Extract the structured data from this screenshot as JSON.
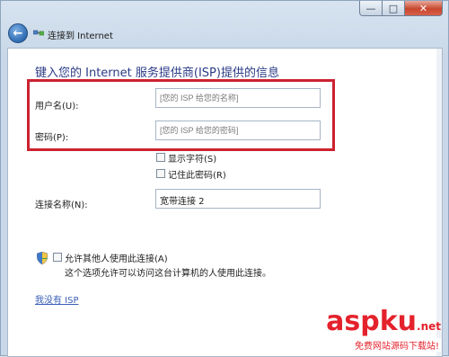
{
  "window": {
    "caption_minimize": "—",
    "caption_maximize": "□",
    "caption_close": "✕"
  },
  "nav": {
    "back_icon": "back-arrow-icon",
    "title": "连接到 Internet"
  },
  "form": {
    "heading": "键入您的 Internet 服务提供商(ISP)提供的信息",
    "username_label": "用户名(U):",
    "username_placeholder": "[您的 ISP 给您的名称]",
    "password_label": "密码(P):",
    "password_placeholder": "[您的 ISP 给您的密码]",
    "show_chars_label": "显示字符(S)",
    "remember_password_label": "记住此密码(R)",
    "connection_name_label": "连接名称(N):",
    "connection_name_value": "宽带连接 2",
    "allow_others_label": "允许其他人使用此连接(A)",
    "allow_others_desc": "这个选项允许可以访问这台计算机的人使用此连接。",
    "no_isp_link": "我没有 ISP"
  },
  "watermark": {
    "brand": "aspku",
    "domain_suffix": ".net",
    "tagline": "免费网站源码下载站!"
  },
  "colors": {
    "highlight": "#cc2231",
    "heading": "#2a3a86",
    "link": "#3a5fb8"
  }
}
